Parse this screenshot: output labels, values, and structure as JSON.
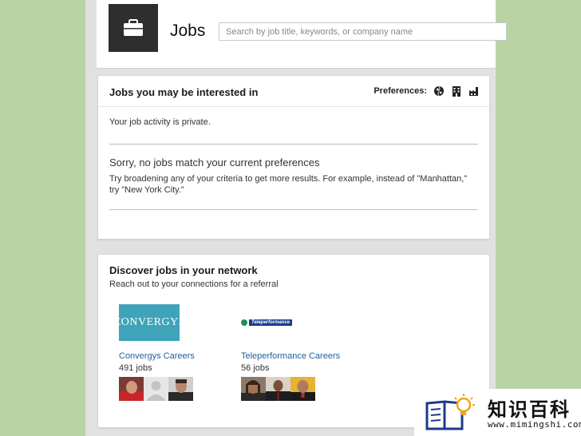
{
  "header": {
    "title": "Jobs",
    "search_placeholder": "Search by job title, keywords, or company name",
    "brand_icon": "briefcase-icon"
  },
  "interested": {
    "title": "Jobs you may be interested in",
    "preferences_label": "Preferences:",
    "preference_icons": [
      "globe-icon",
      "building-icon",
      "factory-icon"
    ],
    "privacy_text": "Your job activity is private.",
    "no_match_title": "Sorry, no jobs match your current preferences",
    "no_match_text": "Try broadening any of your criteria to get more results. For example, instead of \"Manhattan,\" try \"New York City.\""
  },
  "network": {
    "title": "Discover jobs in your network",
    "subtitle": "Reach out to your connections for a referral",
    "companies": [
      {
        "logo_text": "CONVERGYS",
        "name": "Convergys Careers",
        "jobs": "491 jobs"
      },
      {
        "logo_text": "Teleperformance",
        "name": "Teleperformance Careers",
        "jobs": "56 jobs"
      }
    ]
  },
  "watermark": {
    "title": "知识百科",
    "url": "www.mimingshi.com"
  },
  "colors": {
    "page_background": "#b9d3a6",
    "link": "#1f5f9a",
    "convergys_brand": "#3fa4ba",
    "teleperformance_brand": "#1c3d8c"
  }
}
